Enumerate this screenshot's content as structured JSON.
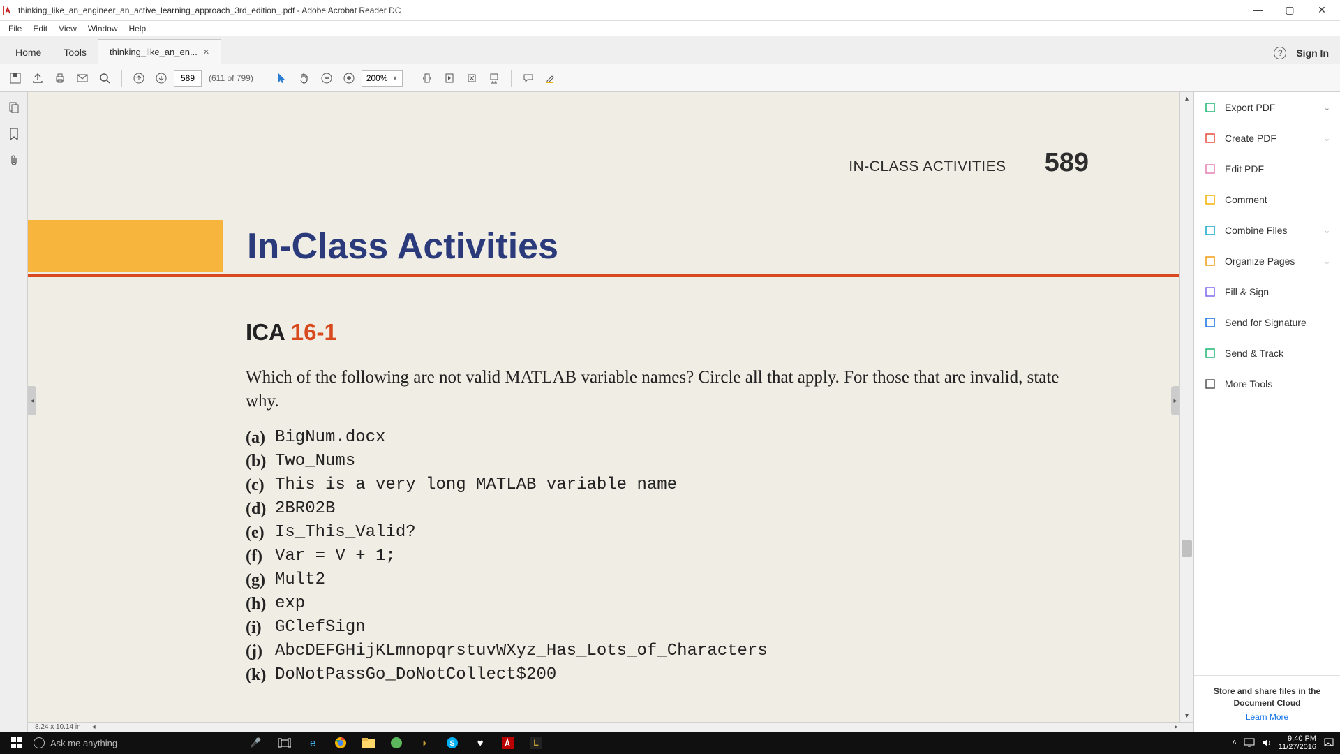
{
  "window": {
    "title": "thinking_like_an_engineer_an_active_learning_approach_3rd_edition_.pdf - Adobe Acrobat Reader DC"
  },
  "menu": {
    "items": [
      "File",
      "Edit",
      "View",
      "Window",
      "Help"
    ]
  },
  "tabs": {
    "home": "Home",
    "tools": "Tools",
    "doc": "thinking_like_an_en...",
    "help_glyph": "?",
    "signin": "Sign In"
  },
  "toolbar": {
    "page_current": "589",
    "page_total": "(611 of 799)",
    "zoom": "200%"
  },
  "document": {
    "header_label": "IN-CLASS ACTIVITIES",
    "page_number": "589",
    "section_title": "In-Class Activities",
    "ica_prefix": "ICA ",
    "ica_number": "16-1",
    "question": "Which of the following are not valid MATLAB variable names? Circle all that apply. For those that are invalid, state why.",
    "options": [
      {
        "letter": "(a)",
        "code": "BigNum.docx"
      },
      {
        "letter": "(b)",
        "code": "Two_Nums"
      },
      {
        "letter": "(c)",
        "code": "This is a very long MATLAB variable name"
      },
      {
        "letter": "(d)",
        "code": "2BR02B"
      },
      {
        "letter": "(e)",
        "code": "Is_This_Valid?"
      },
      {
        "letter": "(f)",
        "code": "Var = V + 1;"
      },
      {
        "letter": "(g)",
        "code": "Mult2"
      },
      {
        "letter": "(h)",
        "code": "exp"
      },
      {
        "letter": "(i)",
        "code": "GClefSign"
      },
      {
        "letter": "(j)",
        "code": "AbcDEFGHijKLmnopqrstuvWXyz_Has_Lots_of_Characters"
      },
      {
        "letter": "(k)",
        "code": "DoNotPassGo_DoNotCollect$200"
      }
    ],
    "page_dim": "8.24 x 10.14 in"
  },
  "right_panel": {
    "items": [
      {
        "label": "Export PDF",
        "color": "#1fb574",
        "chev": true
      },
      {
        "label": "Create PDF",
        "color": "#e74b3c",
        "chev": true
      },
      {
        "label": "Edit PDF",
        "color": "#e67fb1",
        "chev": false
      },
      {
        "label": "Comment",
        "color": "#f2b200",
        "chev": false
      },
      {
        "label": "Combine Files",
        "color": "#17a8c7",
        "chev": true
      },
      {
        "label": "Organize Pages",
        "color": "#f39c12",
        "chev": true
      },
      {
        "label": "Fill & Sign",
        "color": "#7b68ee",
        "chev": false
      },
      {
        "label": "Send for Signature",
        "color": "#1473e6",
        "chev": false
      },
      {
        "label": "Send & Track",
        "color": "#1fb574",
        "chev": false
      },
      {
        "label": "More Tools",
        "color": "#555555",
        "chev": false
      }
    ],
    "promo_line1": "Store and share files in the",
    "promo_line2": "Document Cloud",
    "promo_link": "Learn More"
  },
  "taskbar": {
    "search_placeholder": "Ask me anything",
    "time": "9:40 PM",
    "date": "11/27/2016"
  }
}
